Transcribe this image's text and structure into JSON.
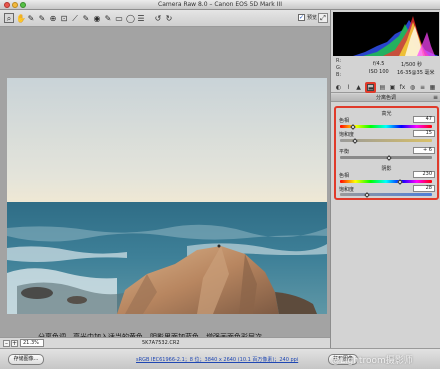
{
  "window": {
    "title": "Camera Raw 8.0 – Canon EOS 5D Mark III"
  },
  "toolbar": {
    "tools": [
      {
        "name": "zoom-tool-icon",
        "glyph": "⌕"
      },
      {
        "name": "hand-tool-icon",
        "glyph": "✋"
      },
      {
        "name": "white-balance-tool-icon",
        "glyph": "✎"
      },
      {
        "name": "color-sampler-tool-icon",
        "glyph": "✎"
      },
      {
        "name": "targeted-adjustment-tool-icon",
        "glyph": "⊕"
      },
      {
        "name": "crop-tool-icon",
        "glyph": "⊡"
      },
      {
        "name": "straighten-tool-icon",
        "glyph": "⟋"
      },
      {
        "name": "spot-removal-tool-icon",
        "glyph": "✎"
      },
      {
        "name": "red-eye-tool-icon",
        "glyph": "◉"
      },
      {
        "name": "adjustment-brush-icon",
        "glyph": "✎"
      },
      {
        "name": "graduated-filter-icon",
        "glyph": "▭"
      },
      {
        "name": "radial-filter-icon",
        "glyph": "◯"
      },
      {
        "name": "preferences-icon",
        "glyph": "☰"
      },
      {
        "name": "rotate-left-icon",
        "glyph": "↺"
      },
      {
        "name": "rotate-right-icon",
        "glyph": "↻"
      }
    ],
    "preview_label": "预览"
  },
  "histogram": {
    "r": "R:",
    "g": "G:",
    "b": "B:"
  },
  "exif": {
    "aperture": "f/4.5",
    "shutter": "1/500 秒",
    "iso": "ISO 100",
    "lens": "16-35@35 毫米"
  },
  "panel": {
    "title": "分离色调",
    "highlights": {
      "title": "高光",
      "hue": {
        "label": "色相",
        "value": "47"
      },
      "saturation": {
        "label": "饱和度",
        "value": "15"
      }
    },
    "balance": {
      "label": "平衡",
      "value": "+ 6"
    },
    "shadows": {
      "title": "阴影",
      "hue": {
        "label": "色相",
        "value": "230"
      },
      "saturation": {
        "label": "饱和度",
        "value": "28"
      }
    }
  },
  "caption": "分离色调，高光中加入适当的黄色，阴影里面加蓝色，增强画面色彩层次",
  "zoom": {
    "minus": "–",
    "value": "21.3%",
    "plus": "+"
  },
  "filename": "5K7A7532.CR2",
  "footer": {
    "save_label": "存储图像...",
    "workflow_link": "sRGB IEC61966-2.1；8 位；3840 x 2640 (10.1 百万像素)；240 ppi",
    "open_label": "打开图像",
    "watermark": "@Lightroom摄影师"
  },
  "colors": {
    "accent_red": "#e03a2a",
    "link_blue": "#1f47b3"
  }
}
